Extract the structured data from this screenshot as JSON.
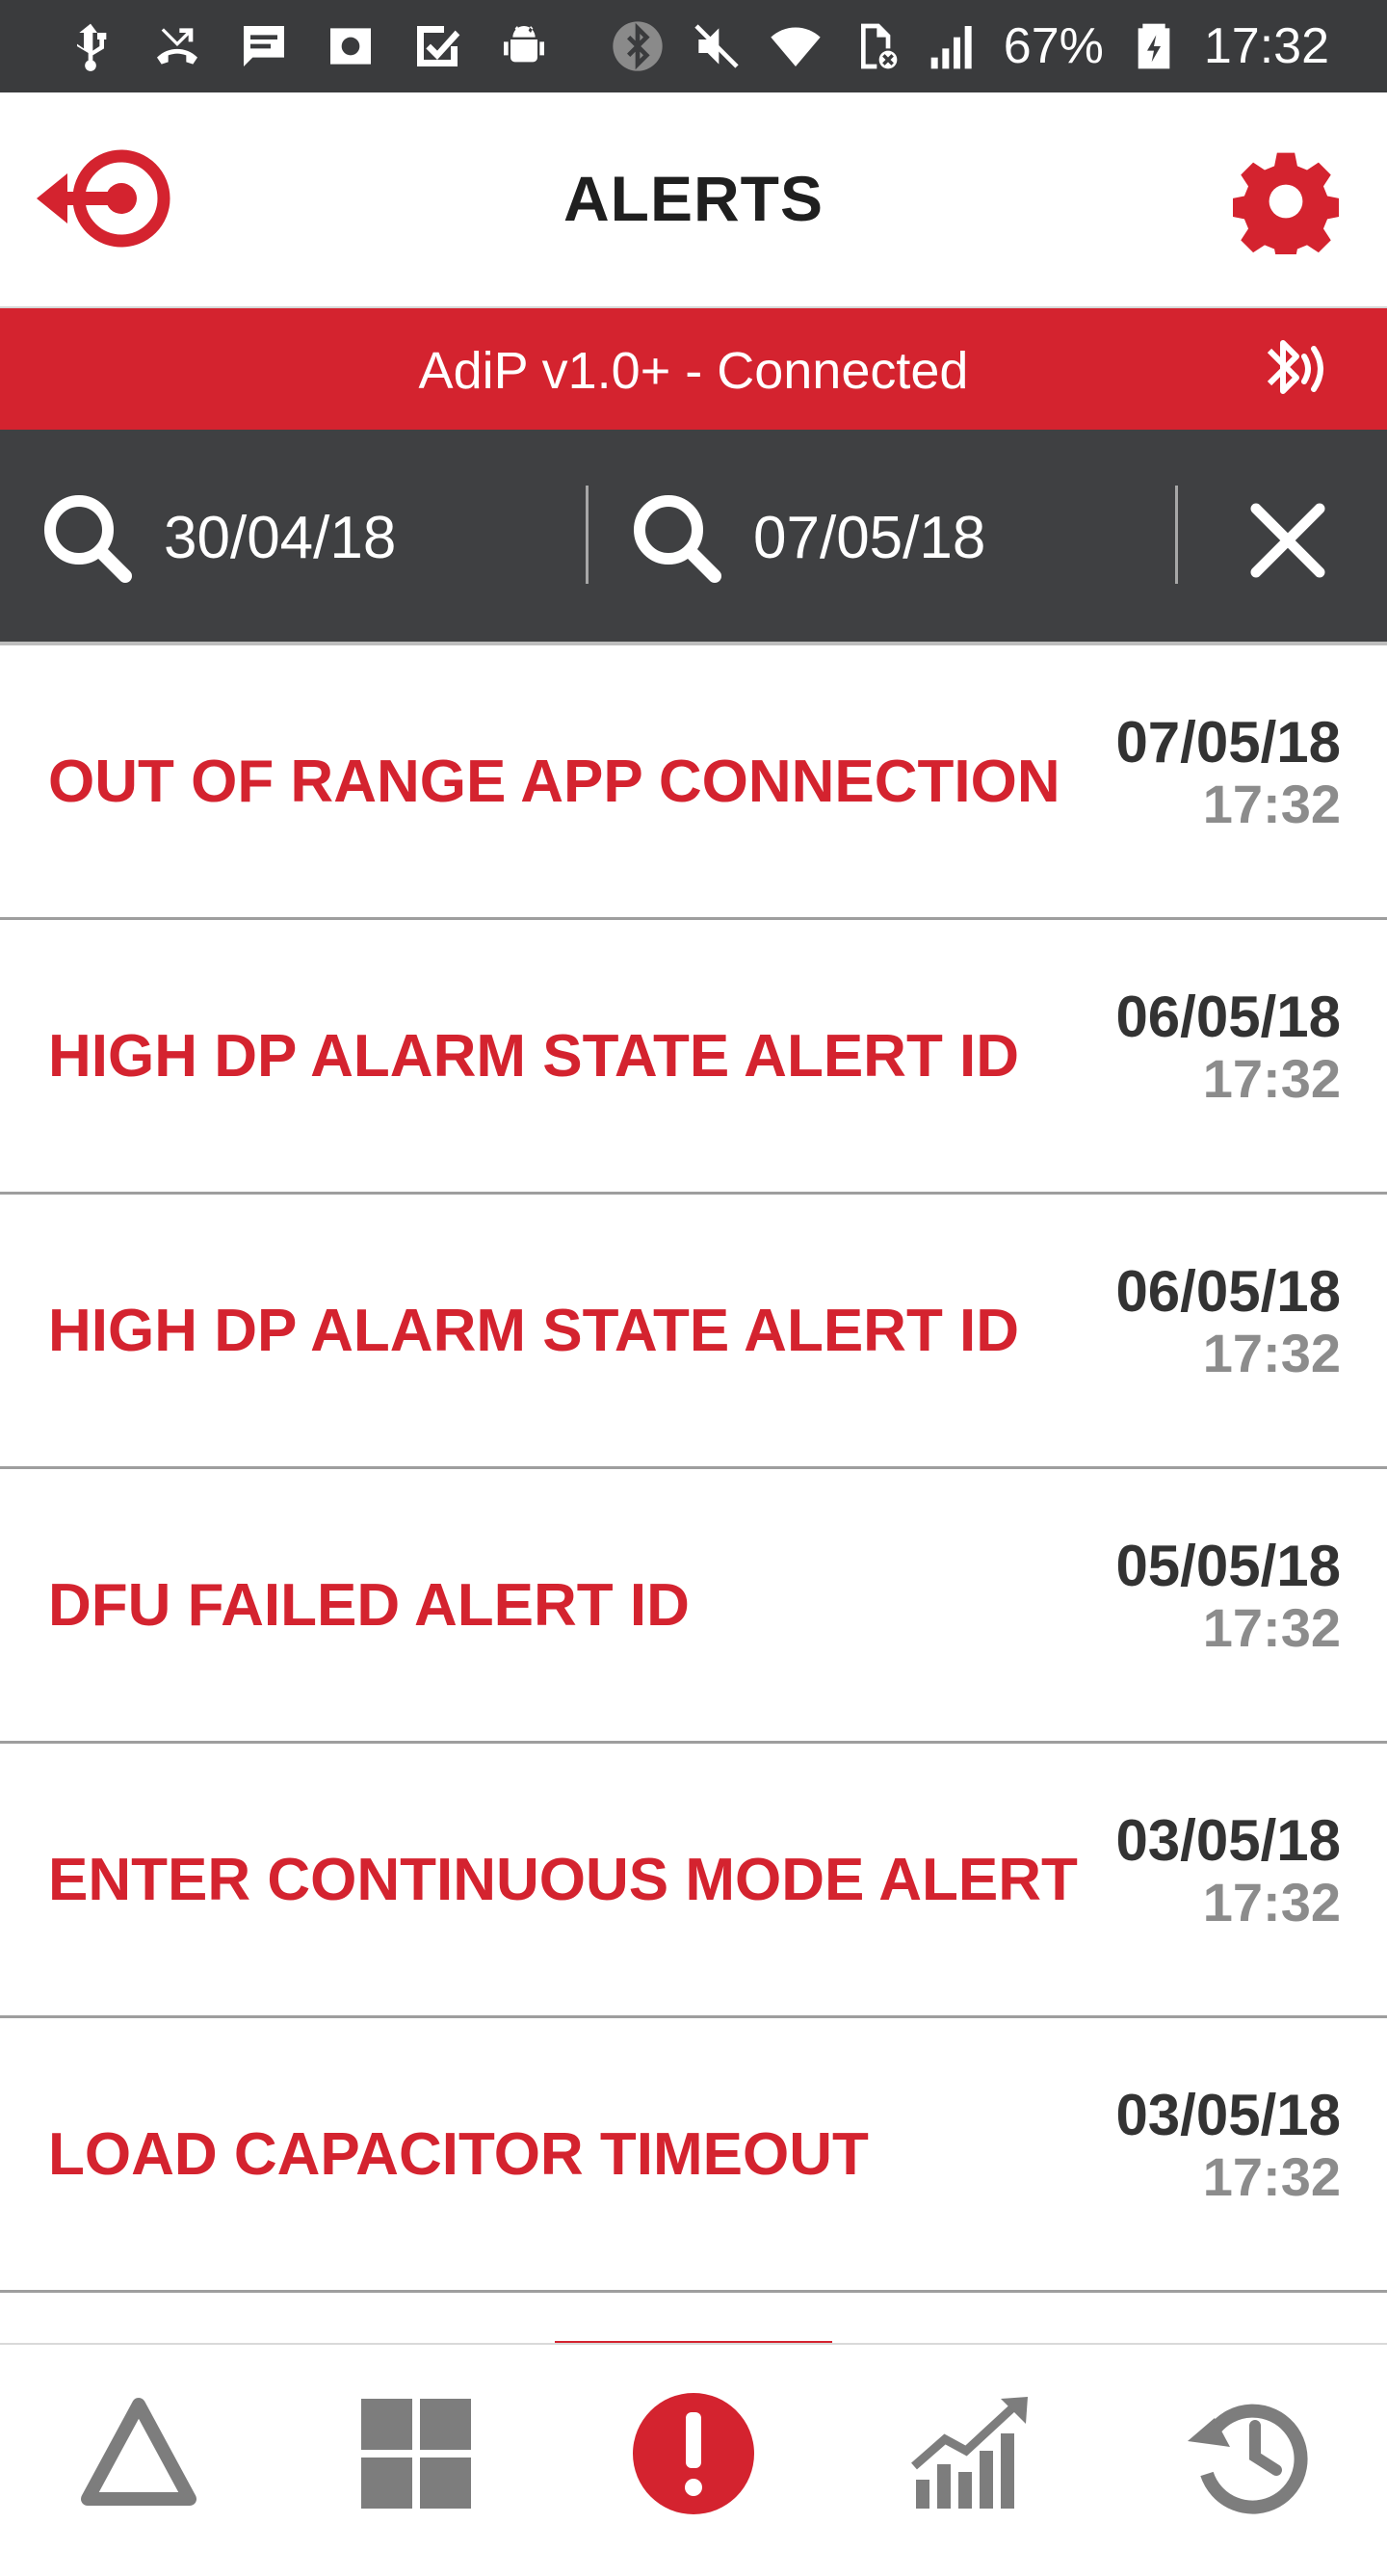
{
  "status_bar": {
    "battery_percent": "67%",
    "time": "17:32",
    "left_icons": [
      "usb-icon",
      "missed-call-icon",
      "message-icon",
      "screenshot-icon",
      "task-check-icon",
      "android-icon"
    ],
    "right_icons": [
      "bluetooth-icon",
      "muted-icon",
      "wifi-icon",
      "no-sim-icon",
      "signal-icon",
      "battery-icon"
    ]
  },
  "header": {
    "title": "ALERTS",
    "back_icon": "logout-target-icon",
    "settings_icon": "gear-icon"
  },
  "connection": {
    "text": "AdiP v1.0+ - Connected",
    "icon": "bluetooth-connected-icon"
  },
  "filter": {
    "from_date": "30/04/18",
    "to_date": "07/05/18",
    "clear_icon": "close-icon"
  },
  "alerts": [
    {
      "title": "OUT OF RANGE APP CONNECTION ...",
      "date": "07/05/18",
      "time": "17:32"
    },
    {
      "title": "HIGH DP ALARM STATE ALERT ID",
      "date": "06/05/18",
      "time": "17:32"
    },
    {
      "title": "HIGH DP ALARM STATE ALERT ID",
      "date": "06/05/18",
      "time": "17:32"
    },
    {
      "title": "DFU FAILED ALERT ID",
      "date": "05/05/18",
      "time": "17:32"
    },
    {
      "title": "ENTER CONTINUOUS MODE ALERT ...",
      "date": "03/05/18",
      "time": "17:32"
    },
    {
      "title": "LOAD CAPACITOR TIMEOUT",
      "date": "03/05/18",
      "time": "17:32"
    }
  ],
  "nav": {
    "tabs": [
      "triangle-icon",
      "dashboard-grid-icon",
      "alert-icon",
      "chart-icon",
      "history-icon"
    ],
    "active_index": 2
  },
  "colors": {
    "brand_red": "#d4232f",
    "dark_bar": "#3f4042",
    "nav_gray": "#7d7d7d"
  }
}
